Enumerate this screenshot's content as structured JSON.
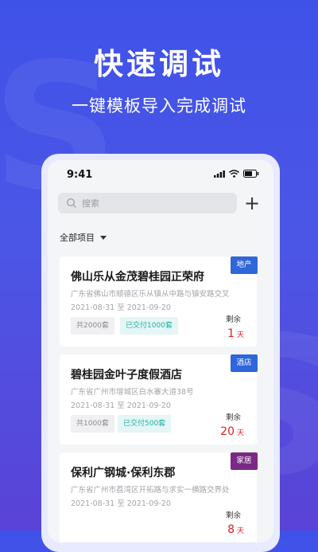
{
  "headline": "快速调试",
  "subline": "一键模板导入完成调试",
  "phone": {
    "status_time": "9:41",
    "search_placeholder": "搜索",
    "add_symbol": "+",
    "filter_label": "全部项目"
  },
  "remain_label": "剩余",
  "day_unit": "天",
  "colors": {
    "accent": "#3f52e8",
    "tag_blue": "#2f66d9",
    "tag_purple": "#7a2a86",
    "remain_red": "#e02020",
    "done_green": "#24b0a6"
  },
  "projects": [
    {
      "tag": "地产",
      "title": "佛山乐从金茂碧桂园正荣府",
      "address": "广东省佛山市顺德区乐从镇从中路与镇安路交叉",
      "date": "2021-08-31 至 2021-09-20",
      "total": "共2000套",
      "delivered": "已交付1000套",
      "days": "1"
    },
    {
      "tag": "酒店",
      "title": "碧桂园金叶子度假酒店",
      "address": "广东省广州市增城区白水寨大道38号",
      "date": "2021-08-31 至 2021-09-20",
      "total": "共1000套",
      "delivered": "已交付500套",
      "days": "20"
    },
    {
      "tag": "家居",
      "title": "保利广钢城·保利东郡",
      "address": "广东省广州市荔湾区开拓路与求实一横路交界处",
      "date": "2021-08-31 至 2021-09-20",
      "days": "8"
    }
  ]
}
